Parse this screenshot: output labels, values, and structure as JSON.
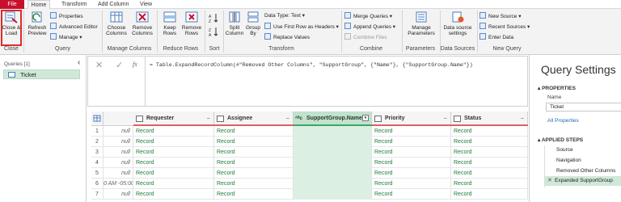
{
  "tabs": [
    "File",
    "Home",
    "Transform",
    "Add Column",
    "View"
  ],
  "ribbon": {
    "close_group": {
      "label": "Close",
      "close_load": "Close &\nLoad"
    },
    "query_group": {
      "label": "Query",
      "refresh": "Refresh\nPreview",
      "properties": "Properties",
      "advanced_editor": "Advanced Editor",
      "manage": "Manage"
    },
    "manage_columns_group": {
      "label": "Manage Columns",
      "choose": "Choose\nColumns",
      "remove": "Remove\nColumns"
    },
    "reduce_rows_group": {
      "label": "Reduce Rows",
      "keep": "Keep\nRows",
      "remove": "Remove\nRows"
    },
    "sort_group": {
      "label": "Sort"
    },
    "transform_group": {
      "label": "Transform",
      "split": "Split\nColumn",
      "group": "Group\nBy",
      "data_type": "Data Type: Text",
      "first_row": "Use First Row as Headers",
      "replace": "Replace Values"
    },
    "combine_group": {
      "label": "Combine",
      "merge": "Merge Queries",
      "append": "Append Queries",
      "combine_files": "Combine Files"
    },
    "parameters_group": {
      "label": "Parameters",
      "manage": "Manage\nParameters"
    },
    "data_sources_group": {
      "label": "Data Sources",
      "settings": "Data source\nsettings"
    },
    "new_query_group": {
      "label": "New Query",
      "new_source": "New Source",
      "recent_sources": "Recent Sources",
      "enter_data": "Enter Data"
    }
  },
  "queries": {
    "header": "Queries [1]",
    "items": [
      "Ticket"
    ]
  },
  "formula": "= Table.ExpandRecordColumn(#\"Removed Other Columns\", \"SupportGroup\", {\"Name\"}, {\"SupportGroup.Name\"})",
  "grid": {
    "columns": [
      "Requester",
      "Assignee",
      "SupportGroup.Name",
      "Priority",
      "Status"
    ],
    "rows": [
      {
        "n": "1",
        "first": "null",
        "vals": [
          "Record",
          "Record",
          "",
          "Record",
          "Record"
        ]
      },
      {
        "n": "2",
        "first": "null",
        "vals": [
          "Record",
          "Record",
          "",
          "Record",
          "Record"
        ]
      },
      {
        "n": "3",
        "first": "null",
        "vals": [
          "Record",
          "Record",
          "",
          "Record",
          "Record"
        ]
      },
      {
        "n": "4",
        "first": "null",
        "vals": [
          "Record",
          "Record",
          "",
          "Record",
          "Record"
        ]
      },
      {
        "n": "5",
        "first": "null",
        "vals": [
          "Record",
          "Record",
          "",
          "Record",
          "Record"
        ]
      },
      {
        "n": "6",
        "first": "0 AM -05:00",
        "vals": [
          "Record",
          "Record",
          "",
          "Record",
          "Record"
        ]
      },
      {
        "n": "7",
        "first": "null",
        "vals": [
          "Record",
          "Record",
          "",
          "Record",
          "Record"
        ]
      }
    ]
  },
  "settings": {
    "title": "Query Settings",
    "properties_header": "PROPERTIES",
    "name_label": "Name",
    "name_value": "Ticket",
    "all_properties": "All Properties",
    "applied_steps_header": "APPLIED STEPS",
    "steps": [
      "Source",
      "Navigation",
      "Removed Other Columns",
      "Expanded SupportGroup"
    ]
  }
}
